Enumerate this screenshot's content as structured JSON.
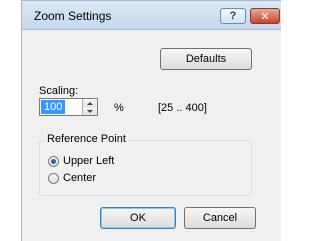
{
  "window": {
    "title": "Zoom Settings",
    "help_label": "?",
    "close_label": "✕"
  },
  "toolbar": {
    "defaults_label": "Defaults"
  },
  "scaling": {
    "label": "Scaling:",
    "value": "100",
    "unit": "%",
    "range": "[25 .. 400]"
  },
  "reference_point": {
    "legend": "Reference Point",
    "options": [
      {
        "label": "Upper Left",
        "selected": true
      },
      {
        "label": "Center",
        "selected": false
      }
    ]
  },
  "footer": {
    "ok_label": "OK",
    "cancel_label": "Cancel"
  }
}
